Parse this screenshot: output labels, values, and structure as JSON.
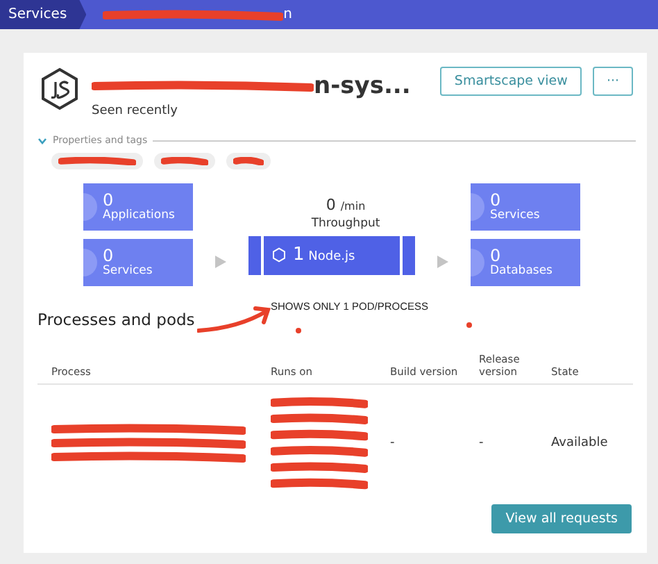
{
  "breadcrumb": [
    {
      "label": "Services",
      "redacted": false
    },
    {
      "label": "n",
      "redacted": true
    }
  ],
  "header": {
    "title": "n-sys...",
    "title_redacted": true,
    "status": "Seen recently",
    "buttons": [
      "Smartscape view",
      "···"
    ]
  },
  "properties": {
    "label": "Properties and tags",
    "expanded": true,
    "tags": [
      {
        "redacted": true
      },
      {
        "redacted": true
      },
      {
        "redacted": true
      }
    ]
  },
  "flow": {
    "callers": [
      {
        "count": "0",
        "label": "Applications"
      },
      {
        "count": "0",
        "label": "Services"
      }
    ],
    "throughput": {
      "value": "0",
      "unit": "/min",
      "label": "Throughput"
    },
    "process_group": {
      "count": "1",
      "label": "Node.js"
    },
    "callees": [
      {
        "count": "0",
        "label": "Services"
      },
      {
        "count": "0",
        "label": "Databases"
      }
    ]
  },
  "section_title": "Processes and pods",
  "annotation": {
    "text": "SHOWS ONLY 1 POD/PROCESS"
  },
  "table": {
    "columns": [
      "Process",
      "Runs on",
      "Build version",
      "Release version",
      "State"
    ],
    "rows": [
      {
        "process_redacted": true,
        "runs_on_redacted": true,
        "build_version": "-",
        "release_version": "-",
        "state": "Available"
      }
    ]
  },
  "footer_button": "View all requests"
}
